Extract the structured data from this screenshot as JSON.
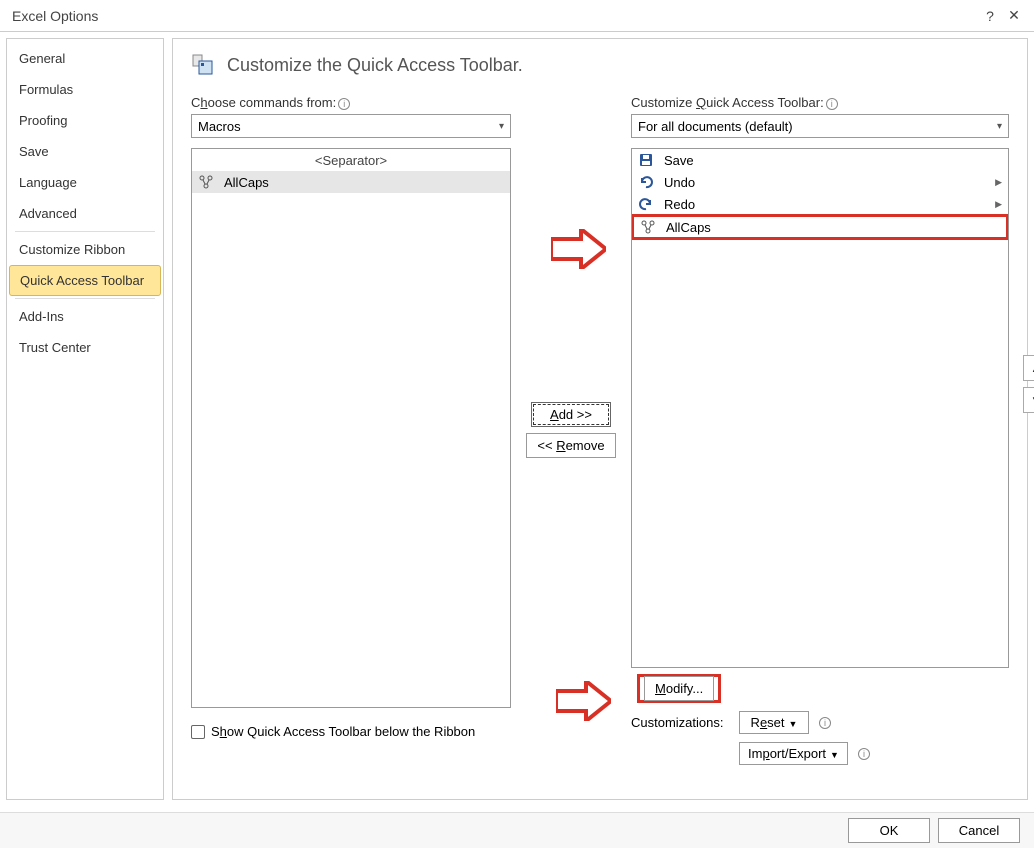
{
  "title": "Excel Options",
  "sidebar": {
    "items": [
      {
        "label": "General"
      },
      {
        "label": "Formulas"
      },
      {
        "label": "Proofing"
      },
      {
        "label": "Save"
      },
      {
        "label": "Language"
      },
      {
        "label": "Advanced"
      },
      {
        "label": "Customize Ribbon"
      },
      {
        "label": "Quick Access Toolbar",
        "active": true
      },
      {
        "label": "Add-Ins"
      },
      {
        "label": "Trust Center"
      }
    ]
  },
  "header": {
    "text": "Customize the Quick Access Toolbar."
  },
  "leftCol": {
    "label_pre": "C",
    "label_und": "h",
    "label_post": "oose commands from:",
    "combo": "Macros",
    "items": [
      {
        "label": "<Separator>",
        "kind": "sep"
      },
      {
        "label": "AllCaps",
        "icon": "macro",
        "selected": true
      }
    ]
  },
  "mid": {
    "add_und": "A",
    "add_post": "dd >>",
    "remove_pre": "<< ",
    "remove_und": "R",
    "remove_post": "emove"
  },
  "rightCol": {
    "label_pre": "Customize ",
    "label_und": "Q",
    "label_post": "uick Access Toolbar:",
    "combo": "For all documents (default)",
    "items": [
      {
        "label": "Save",
        "icon": "save"
      },
      {
        "label": "Undo",
        "icon": "undo",
        "flyout": true
      },
      {
        "label": "Redo",
        "icon": "redo",
        "flyout": true
      },
      {
        "label": "AllCaps",
        "icon": "macro",
        "highlight": true
      }
    ],
    "modify_und": "M",
    "modify_post": "odify...",
    "cust_label": "Customizations:",
    "reset_pre": "R",
    "reset_und": "e",
    "reset_post": "set",
    "import_pre": "Im",
    "import_und": "p",
    "import_post": "ort/Export"
  },
  "checkbox": {
    "pre": "S",
    "und": "h",
    "post": "ow Quick Access Toolbar below the Ribbon"
  },
  "footer": {
    "ok": "OK",
    "cancel": "Cancel"
  }
}
